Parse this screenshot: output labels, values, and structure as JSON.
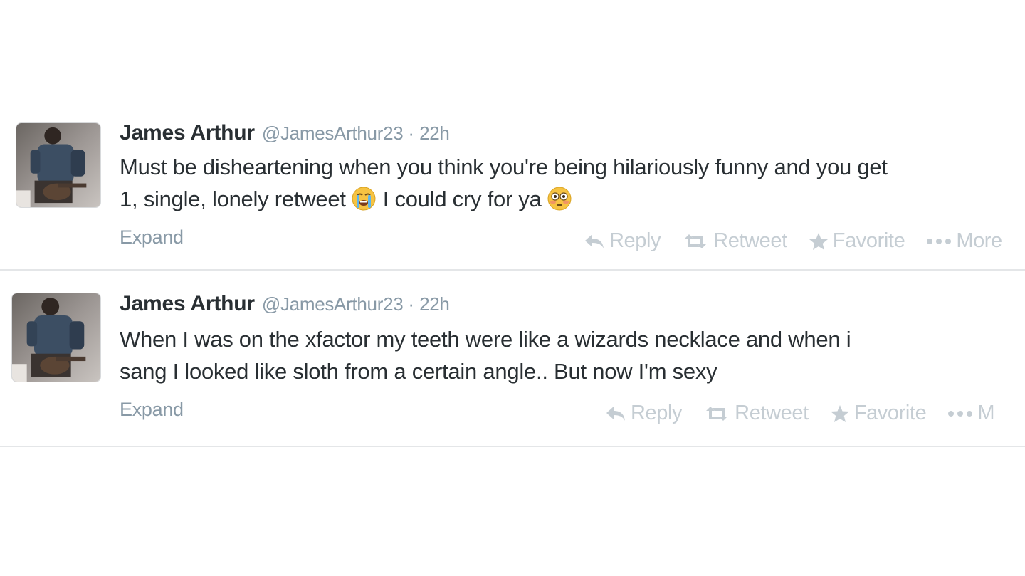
{
  "tweets": [
    {
      "fullname": "James Arthur",
      "username": "@JamesArthur23",
      "separator": "·",
      "time": "22h",
      "text_line1": "Must be disheartening when you think you're being hilariously funny and you get",
      "text_line2_a": "1, single, lonely retweet",
      "text_line2_b": "I could cry for ya",
      "emoji_1": "crying-face-emoji",
      "emoji_2": "flushed-face-emoji",
      "expand_label": "Expand",
      "actions": {
        "reply": "Reply",
        "retweet": "Retweet",
        "favorite": "Favorite",
        "more": "More"
      }
    },
    {
      "fullname": "James Arthur",
      "username": "@JamesArthur23",
      "separator": "·",
      "time": "22h",
      "text_line1": "When I was on the xfactor my teeth were like a wizards necklace and when i",
      "text_line2": "sang I looked like sloth from a certain angle.. But now I'm sexy",
      "expand_label": "Expand",
      "actions": {
        "reply": "Reply",
        "retweet": "Retweet",
        "favorite": "Favorite",
        "more": "M"
      }
    }
  ],
  "colors": {
    "name": "#292f33",
    "meta": "#8899a6",
    "action": "#c5cdd3",
    "divider": "#e4e6e8",
    "background": "#ffffff"
  }
}
